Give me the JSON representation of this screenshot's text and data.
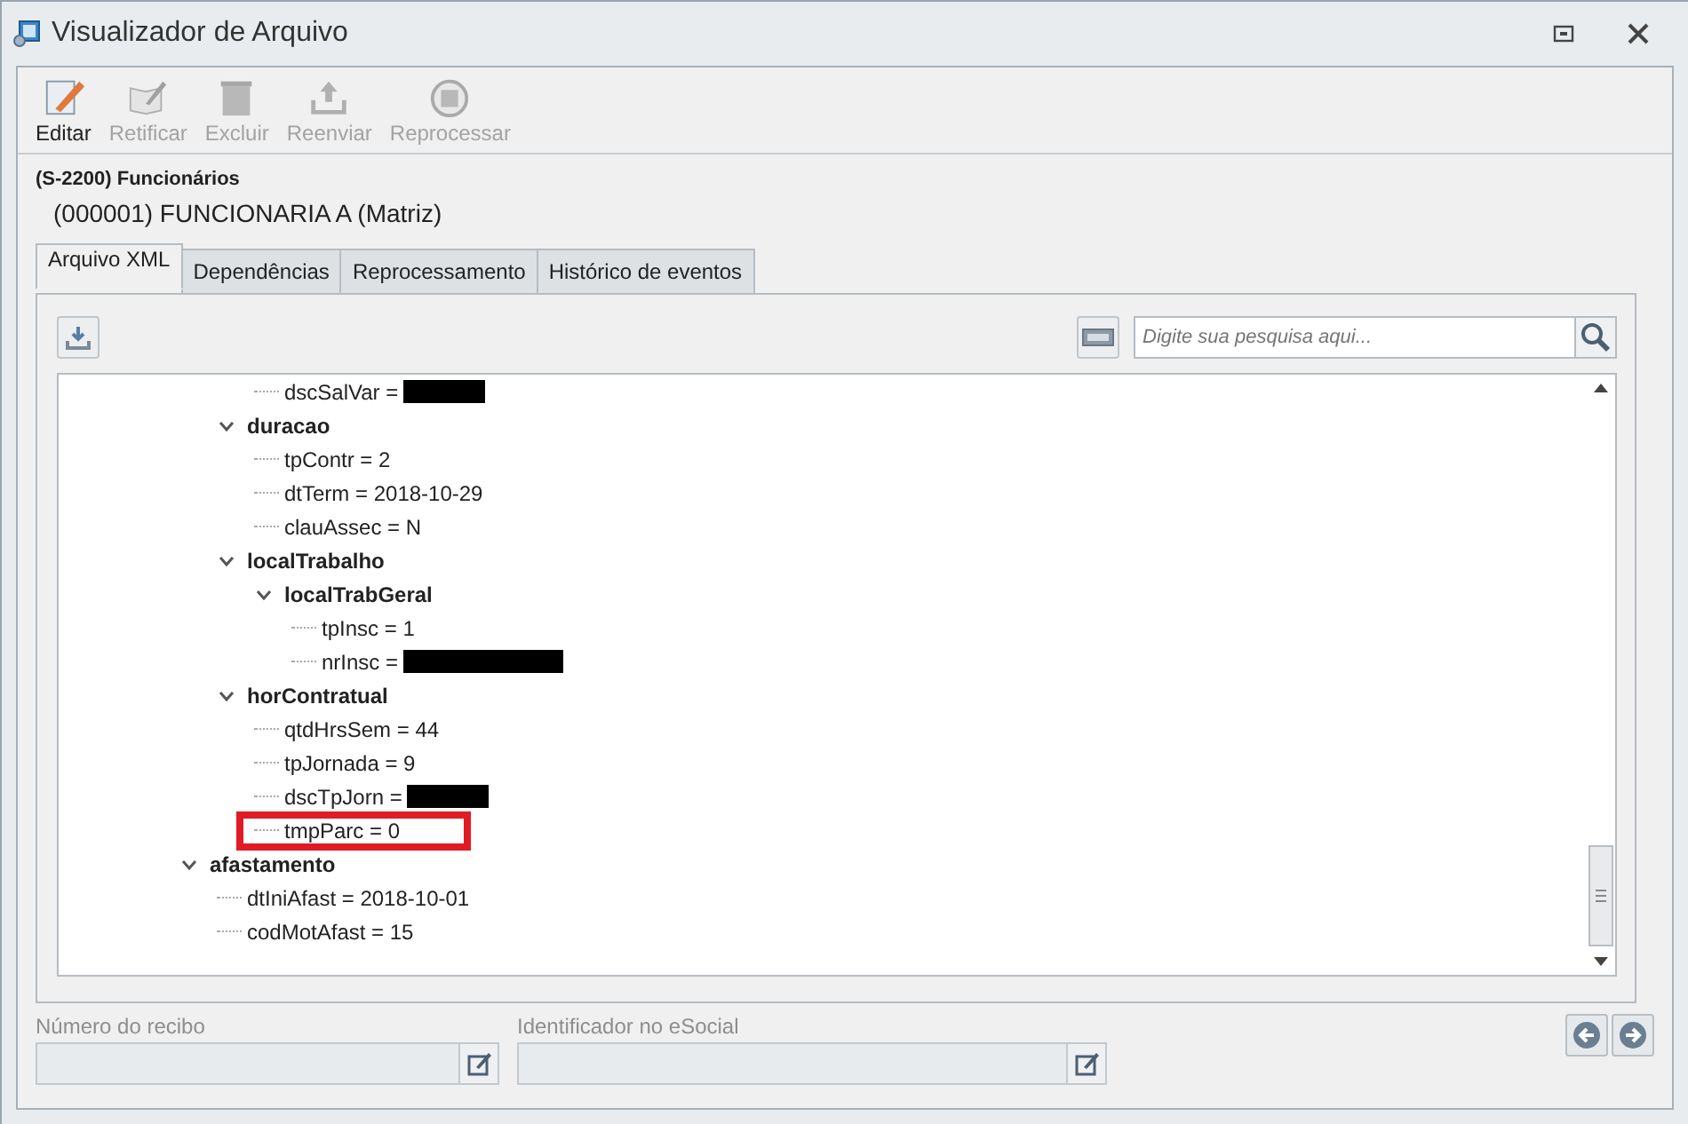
{
  "window": {
    "title": "Visualizador de Arquivo"
  },
  "toolbar": [
    {
      "label": "Editar",
      "kind": "edit",
      "disabled": false
    },
    {
      "label": "Retificar",
      "kind": "rectify",
      "disabled": true
    },
    {
      "label": "Excluir",
      "kind": "delete",
      "disabled": true
    },
    {
      "label": "Reenviar",
      "kind": "upload",
      "disabled": true
    },
    {
      "label": "Reprocessar",
      "kind": "reprocess",
      "disabled": true
    }
  ],
  "header": {
    "event": "(S-2200) Funcionários",
    "employee": "(000001) FUNCIONARIA A (Matriz)"
  },
  "tabs": [
    {
      "label": "Arquivo XML",
      "selected": true
    },
    {
      "label": "Dependências",
      "selected": false
    },
    {
      "label": "Reprocessamento",
      "selected": false
    },
    {
      "label": "Histórico de eventos",
      "selected": false
    }
  ],
  "search": {
    "placeholder": "Digite sua pesquisa aqui..."
  },
  "tree": {
    "children": [
      {
        "children": [
          {
            "children": [
              {
                "text": "dscSalVar =",
                "redacted": true
              }
            ]
          },
          {
            "name": "duracao",
            "expanded": true,
            "children": [
              {
                "text": "tpContr = 2"
              },
              {
                "text": "dtTerm = 2018-10-29"
              },
              {
                "text": "clauAssec = N"
              }
            ]
          },
          {
            "name": "localTrabalho",
            "expanded": true,
            "children": [
              {
                "name": "localTrabGeral",
                "expanded": true,
                "children": [
                  {
                    "text": "tpInsc = 1"
                  },
                  {
                    "text": "nrInsc =",
                    "redacted": true
                  }
                ]
              }
            ]
          },
          {
            "name": "horContratual",
            "expanded": true,
            "children": [
              {
                "text": "qtdHrsSem = 44"
              },
              {
                "text": "tpJornada = 9"
              },
              {
                "text": "dscTpJorn =",
                "redacted": true
              },
              {
                "text": "tmpParc = 0",
                "highlighted": true
              }
            ]
          }
        ]
      },
      {
        "name": "afastamento",
        "expanded": true,
        "children": [
          {
            "text": "dtIniAfast = 2018-10-01"
          },
          {
            "text": "codMotAfast = 15"
          }
        ]
      }
    ]
  },
  "fields": [
    {
      "label": "Número do recibo"
    },
    {
      "label": "Identificador no eSocial"
    }
  ]
}
